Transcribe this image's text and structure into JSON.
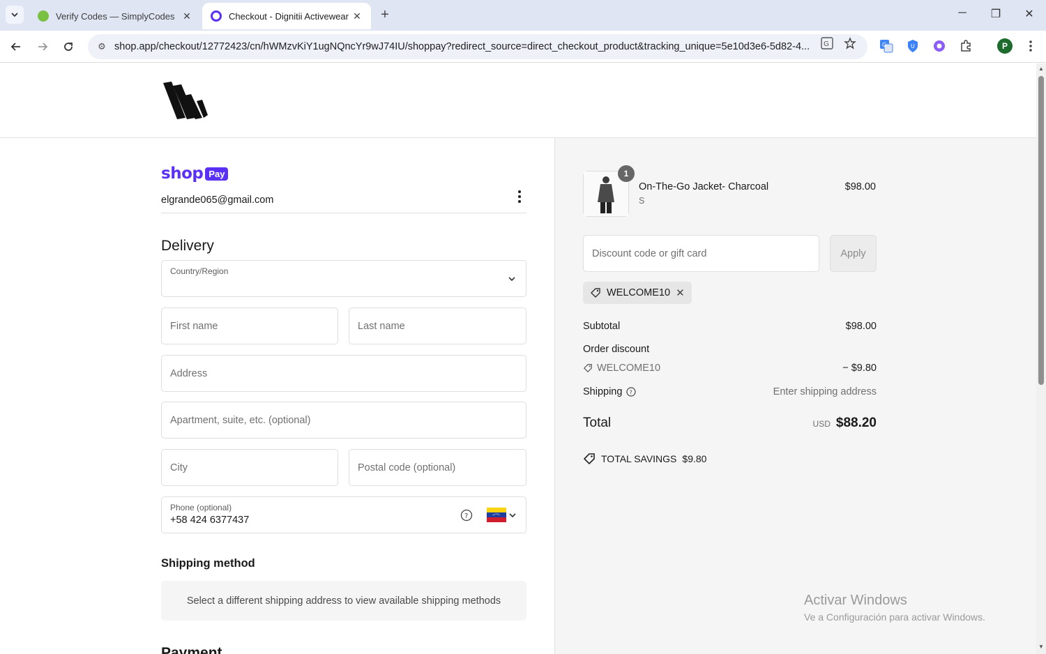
{
  "browser": {
    "tabs": [
      {
        "title": "Verify Codes — SimplyCodes"
      },
      {
        "title": "Checkout - Dignitii Activewear"
      }
    ],
    "url": "shop.app/checkout/12772423/cn/hWMzvKiY1ugNQncYr9wJ74IU/shoppay?redirect_source=direct_checkout_product&tracking_unique=5e10d3e6-5d82-4...",
    "profile_initial": "P"
  },
  "checkout": {
    "brand_shop": "shop",
    "brand_pay": "Pay",
    "email": "elgrande065@gmail.com",
    "delivery_heading": "Delivery",
    "country_label": "Country/Region",
    "first_name_placeholder": "First name",
    "last_name_placeholder": "Last name",
    "address_placeholder": "Address",
    "apartment_placeholder": "Apartment, suite, etc. (optional)",
    "city_placeholder": "City",
    "postal_placeholder": "Postal code (optional)",
    "phone_label": "Phone (optional)",
    "phone_value": "+58 424 6377437",
    "shipping_method_heading": "Shipping method",
    "shipping_method_message": "Select a different shipping address to view available shipping methods",
    "payment_heading": "Payment"
  },
  "summary": {
    "item": {
      "name": "On-The-Go Jacket- Charcoal",
      "variant": "S",
      "price": "$98.00",
      "quantity": "1"
    },
    "discount_placeholder": "Discount code or gift card",
    "apply_label": "Apply",
    "applied_code": "WELCOME10",
    "subtotal_label": "Subtotal",
    "subtotal_value": "$98.00",
    "order_discount_label": "Order discount",
    "discount_code": "WELCOME10",
    "discount_value": "− $9.80",
    "shipping_label": "Shipping",
    "shipping_value": "Enter shipping address",
    "total_label": "Total",
    "total_currency": "USD",
    "total_value": "$88.20",
    "savings_label": "TOTAL SAVINGS",
    "savings_value": "$9.80"
  },
  "watermark": {
    "line1": "Activar Windows",
    "line2": "Ve a Configuración para activar Windows."
  },
  "colors": {
    "shop_purple": "#5a31f4",
    "summary_bg": "#f5f5f5",
    "chrome_bg": "#dfe5f3"
  }
}
